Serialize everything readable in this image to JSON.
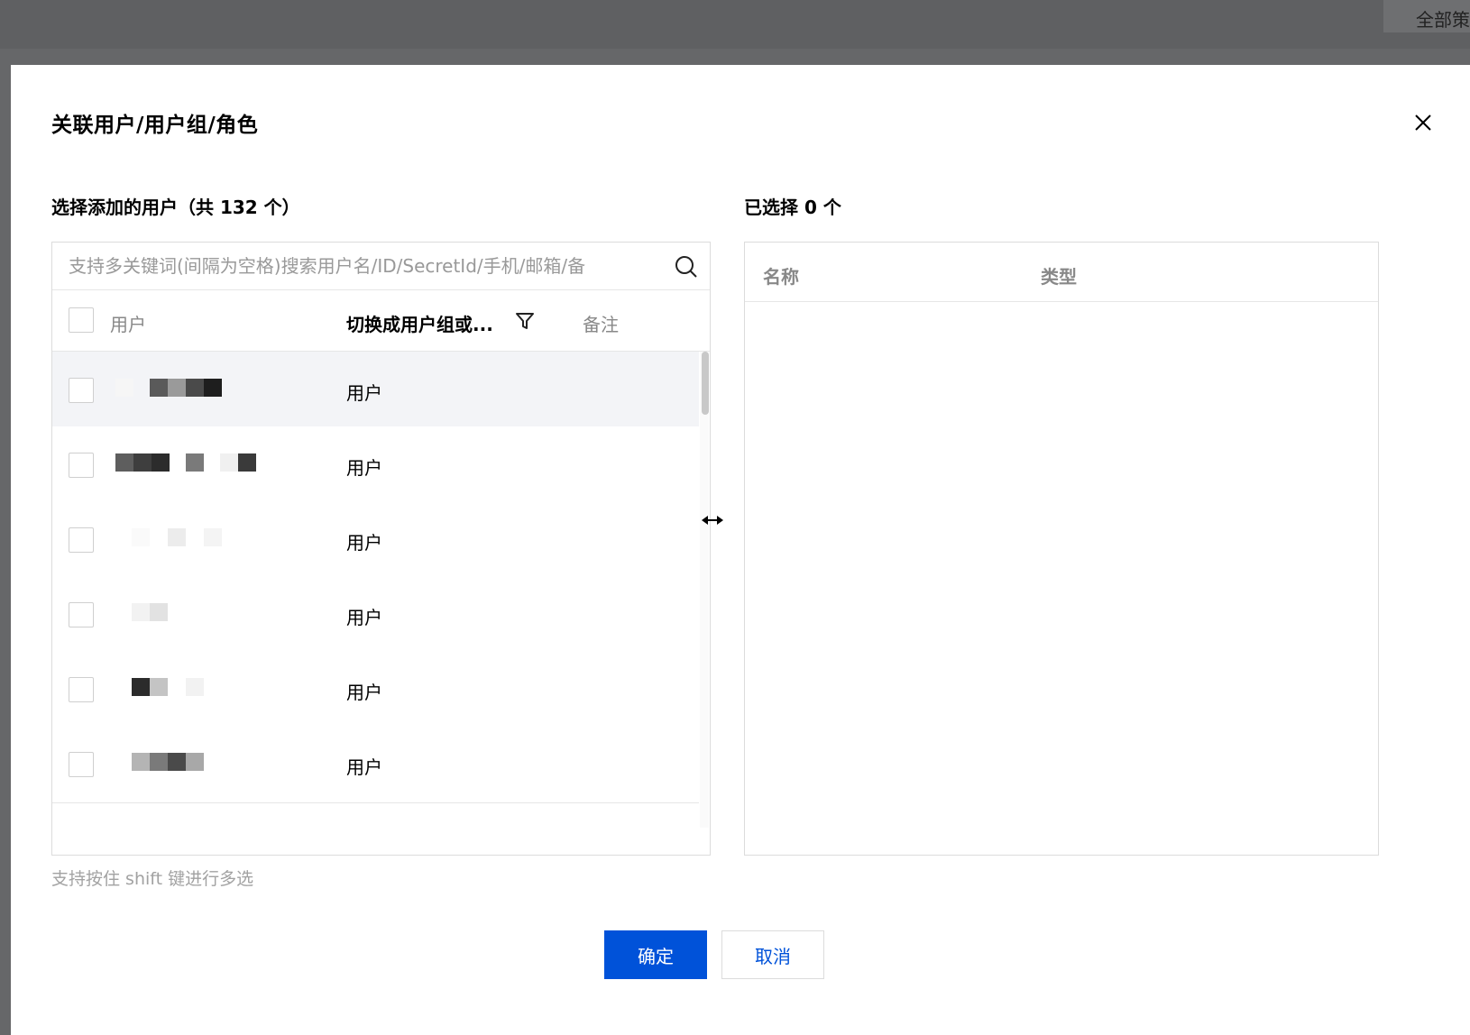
{
  "background": {
    "corner_text": "全部策"
  },
  "dialog": {
    "title": "关联用户/用户组/角色",
    "close_icon": "close-icon"
  },
  "left": {
    "title": "选择添加的用户（共 132 个）",
    "search_placeholder": "支持多关键词(间隔为空格)搜索用户名/ID/SecretId/手机/邮箱/备",
    "columns": {
      "user": "用户",
      "type": "切换成用户组或...",
      "note": "备注"
    },
    "rows": [
      {
        "type": "用户",
        "mosaic": [
          [
            "#f6f6f6",
            0
          ],
          [
            "#5a5a5a",
            38
          ],
          [
            "#9a9a9a",
            58
          ],
          [
            "#4a4a4a",
            78
          ],
          [
            "#1e1e1e",
            98
          ]
        ]
      },
      {
        "type": "用户",
        "mosaic": [
          [
            "#5e5e5e",
            0
          ],
          [
            "#3e3e3e",
            20
          ],
          [
            "#2c2c2c",
            40
          ],
          [
            "#7a7a7a",
            78
          ],
          [
            "#f0f0f0",
            116
          ],
          [
            "#3a3a3a",
            136
          ]
        ]
      },
      {
        "type": "用户",
        "mosaic": [
          [
            "#fafafa",
            18
          ],
          [
            "#ececec",
            58
          ],
          [
            "#f4f4f4",
            98
          ]
        ]
      },
      {
        "type": "用户",
        "mosaic": [
          [
            "#f2f2f2",
            18
          ],
          [
            "#e2e2e2",
            38
          ]
        ]
      },
      {
        "type": "用户",
        "mosaic": [
          [
            "#2b2b2b",
            18
          ],
          [
            "#c4c4c4",
            38
          ],
          [
            "#f2f2f2",
            78
          ]
        ]
      },
      {
        "type": "用户",
        "mosaic": [
          [
            "#b4b4b4",
            18
          ],
          [
            "#7a7a7a",
            38
          ],
          [
            "#4a4a4a",
            58
          ],
          [
            "#a8a8a8",
            78
          ]
        ]
      }
    ],
    "hint": "支持按住 shift 键进行多选"
  },
  "right": {
    "title": "已选择 0 个",
    "columns": {
      "name": "名称",
      "type": "类型"
    }
  },
  "footer": {
    "ok": "确定",
    "cancel": "取消"
  }
}
